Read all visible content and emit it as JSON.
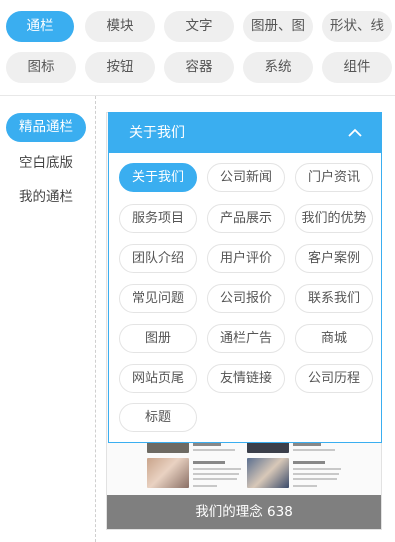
{
  "top_categories": [
    {
      "label": "通栏",
      "active": true
    },
    {
      "label": "模块",
      "active": false
    },
    {
      "label": "文字",
      "active": false
    },
    {
      "label": "图册、图",
      "active": false
    },
    {
      "label": "形状、线",
      "active": false
    },
    {
      "label": "图标",
      "active": false
    },
    {
      "label": "按钮",
      "active": false
    },
    {
      "label": "容器",
      "active": false
    },
    {
      "label": "系统",
      "active": false
    },
    {
      "label": "组件",
      "active": false
    }
  ],
  "side_nav": [
    {
      "label": "精品通栏",
      "active": true
    },
    {
      "label": "空白底版",
      "active": false
    },
    {
      "label": "我的通栏",
      "active": false
    }
  ],
  "dropdown": {
    "selected": "关于我们",
    "options": [
      {
        "label": "关于我们",
        "active": true
      },
      {
        "label": "公司新闻",
        "active": false
      },
      {
        "label": "门户资讯",
        "active": false
      },
      {
        "label": "服务项目",
        "active": false
      },
      {
        "label": "产品展示",
        "active": false
      },
      {
        "label": "我们的优势",
        "active": false
      },
      {
        "label": "团队介绍",
        "active": false
      },
      {
        "label": "用户评价",
        "active": false
      },
      {
        "label": "客户案例",
        "active": false
      },
      {
        "label": "常见问题",
        "active": false
      },
      {
        "label": "公司报价",
        "active": false
      },
      {
        "label": "联系我们",
        "active": false
      },
      {
        "label": "图册",
        "active": false
      },
      {
        "label": "通栏广告",
        "active": false
      },
      {
        "label": "商城",
        "active": false
      },
      {
        "label": "网站页尾",
        "active": false
      },
      {
        "label": "友情链接",
        "active": false
      },
      {
        "label": "公司历程",
        "active": false
      },
      {
        "label": "标题",
        "active": false
      }
    ]
  },
  "preview": {
    "footer_label": "我们的理念 638"
  },
  "colors": {
    "accent": "#3aaef0",
    "pill_bg": "#efefef",
    "footer_bg": "#7f7f7f"
  },
  "icons": {
    "collapse": "chevron-up-icon"
  }
}
